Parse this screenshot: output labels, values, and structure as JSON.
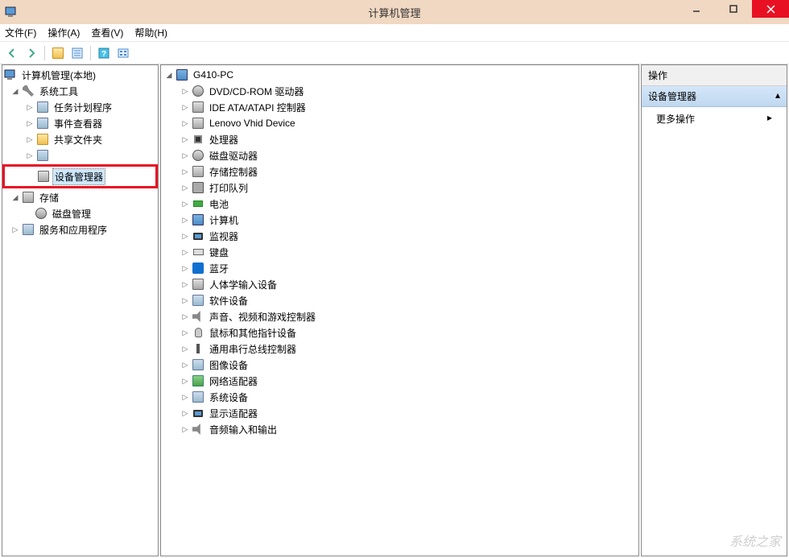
{
  "window": {
    "title": "计算机管理"
  },
  "menubar": {
    "file": "文件(F)",
    "action": "操作(A)",
    "view": "查看(V)",
    "help": "帮助(H)"
  },
  "left_tree": {
    "root": "计算机管理(本地)",
    "system_tools": "系统工具",
    "task_scheduler": "任务计划程序",
    "event_viewer": "事件查看器",
    "shared_folders": "共享文件夹",
    "device_manager": "设备管理器",
    "storage": "存储",
    "disk_mgmt": "磁盘管理",
    "services": "服务和应用程序"
  },
  "mid_tree": {
    "root": "G410-PC",
    "items": [
      "DVD/CD-ROM 驱动器",
      "IDE ATA/ATAPI 控制器",
      "Lenovo Vhid Device",
      "处理器",
      "磁盘驱动器",
      "存储控制器",
      "打印队列",
      "电池",
      "计算机",
      "监视器",
      "键盘",
      "蓝牙",
      "人体学输入设备",
      "软件设备",
      "声音、视频和游戏控制器",
      "鼠标和其他指针设备",
      "通用串行总线控制器",
      "图像设备",
      "网络适配器",
      "系统设备",
      "显示适配器",
      "音频输入和输出"
    ]
  },
  "right_pane": {
    "header": "操作",
    "section": "设备管理器",
    "more": "更多操作"
  },
  "watermark": "系统之家"
}
